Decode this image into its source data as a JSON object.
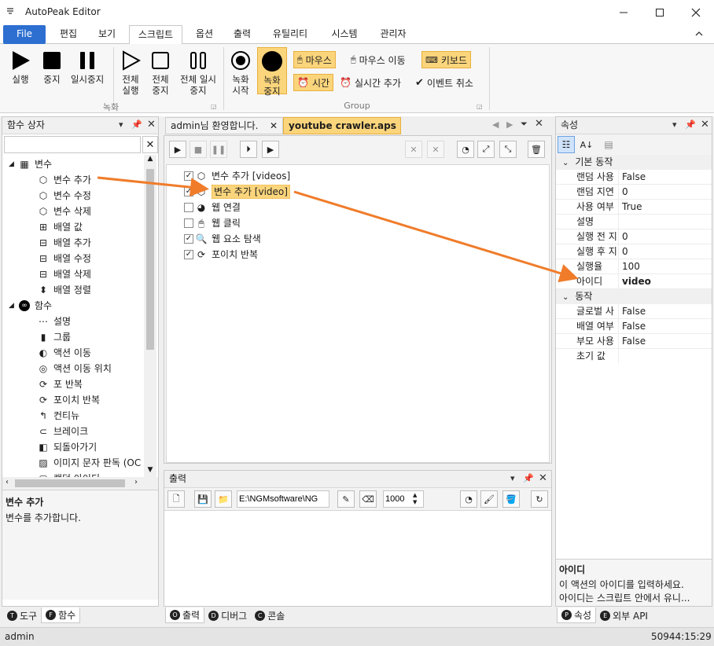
{
  "window": {
    "title": "AutoPeak Editor"
  },
  "menu": {
    "file": "File",
    "tabs": [
      "편집",
      "보기",
      "스크립트",
      "옵션",
      "출력",
      "유틸리티",
      "시스템",
      "관리자"
    ]
  },
  "ribbon": {
    "record_group": {
      "label": "녹화",
      "run": "실행",
      "stop": "중지",
      "pause": "일시중지",
      "run_all": "전체 실행",
      "stop_all": "전체 중지",
      "pause_all": "전체 일시중지"
    },
    "group": {
      "label": "Group",
      "rec_start": "녹화 시작",
      "rec_stop": "녹화 중지",
      "mouse": "마우스",
      "mouse_move": "마우스 이동",
      "keyboard": "키보드",
      "time": "시간",
      "realtime_add": "실시간 추가",
      "event_cancel": "이벤트 취소"
    }
  },
  "function_box": {
    "title": "함수 상자",
    "search_value": "",
    "variables_label": "변수",
    "variable_items": [
      "변수 추가",
      "변수 수정",
      "변수 삭제",
      "배열 값",
      "배열 추가",
      "배열 수정",
      "배열 삭제",
      "배열 정렬"
    ],
    "functions_label": "함수",
    "function_items": [
      "설명",
      "그룹",
      "액션 이동",
      "액션 이동 위치",
      "포 반복",
      "포이치 반복",
      "컨티뉴",
      "브레이크",
      "되돌아가기",
      "이미지 문자 판독 (OC",
      "랜덤 아이디"
    ],
    "desc_title": "변수 추가",
    "desc_text": "변수를 추가합니다."
  },
  "left_tabs": [
    "도구",
    "함수"
  ],
  "left_tab_badges": [
    "T",
    "F"
  ],
  "doc_tabs": [
    {
      "label": "admin님 환영합니다."
    },
    {
      "label": "youtube crawler.aps"
    }
  ],
  "script_items": [
    {
      "label": "변수 추가 [videos]",
      "checked": true
    },
    {
      "label": "변수 추가 [video]",
      "checked": true
    },
    {
      "label": "웹 연결",
      "checked": false
    },
    {
      "label": "웹 클릭",
      "checked": false
    },
    {
      "label": "웹 요소 탐색",
      "checked": true
    },
    {
      "label": "포이치 반복",
      "checked": true
    }
  ],
  "output": {
    "title": "출력",
    "path": "E:\\NGMsoftware\\NG",
    "count": "1000"
  },
  "bottom_tabs": [
    "출력",
    "디버그",
    "콘솔"
  ],
  "bottom_tab_badges": [
    "O",
    "D",
    "C"
  ],
  "properties": {
    "title": "속성",
    "cat_basic": "기본 동작",
    "basic_rows": [
      {
        "k": "랜덤 사용",
        "v": "False"
      },
      {
        "k": "랜덤 지연",
        "v": "0"
      },
      {
        "k": "사용 여부",
        "v": "True"
      },
      {
        "k": "설명",
        "v": ""
      },
      {
        "k": "실행 전 지",
        "v": "0"
      },
      {
        "k": "실행 후 지",
        "v": "0"
      },
      {
        "k": "실행율",
        "v": "100"
      },
      {
        "k": "아이디",
        "v": "video"
      }
    ],
    "cat_action": "동작",
    "action_rows": [
      {
        "k": "글로벌 사",
        "v": "False"
      },
      {
        "k": "배열 여부",
        "v": "False"
      },
      {
        "k": "부모 사용",
        "v": "False"
      },
      {
        "k": "초기 값",
        "v": ""
      }
    ],
    "desc_title": "아이디",
    "desc_line1": "이 액션의 아이디를 입력하세요.",
    "desc_line2": "아이디는 스크립트 안에서 유니..."
  },
  "right_tabs": [
    "속성",
    "외부 API"
  ],
  "right_tab_badges": [
    "P",
    "E"
  ],
  "status": {
    "user": "admin",
    "time": "50944:15:29"
  },
  "colors": {
    "accent": "#2d6fd1",
    "highlight": "#fbd57c",
    "arrow": "#f07c2a"
  }
}
